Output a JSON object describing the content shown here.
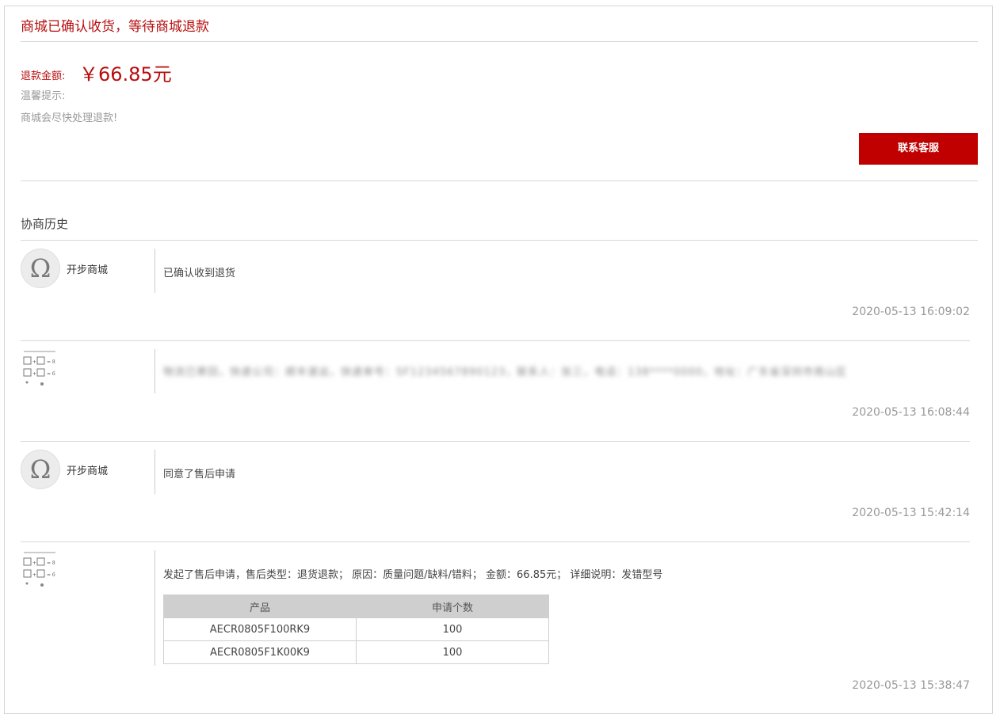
{
  "header": {
    "status_title": "商城已确认收货，等待商城退款"
  },
  "refund": {
    "amount_label": "退款金额:",
    "amount_value": "￥66.85元",
    "tip_label": "温馨提示:",
    "tip_text": "商城会尽快处理退款!",
    "contact_button": "联系客服"
  },
  "history": {
    "title": "协商历史",
    "entries": [
      {
        "author": "开步商城",
        "avatar": "omega-logo-icon",
        "message": "已确认收到退货",
        "time": "2020-05-13 16:09:02"
      },
      {
        "author": "",
        "avatar": "user-qr-avatar-icon",
        "message": "物流已寄回，快递公司：顺丰速运，快递单号：SF1234567890123，联系人：张三，电话：138****0000，地址：广东省深圳市南山区",
        "time": "2020-05-13 16:08:44"
      },
      {
        "author": "开步商城",
        "avatar": "omega-logo-icon",
        "message": "同意了售后申请",
        "time": "2020-05-13 15:42:14"
      },
      {
        "author": "",
        "avatar": "user-qr-avatar-icon",
        "message": "发起了售后申请，售后类型：退货退款； 原因：质量问题/缺料/错料； 金额：66.85元； 详细说明：发错型号",
        "time": "2020-05-13 15:38:47",
        "table": {
          "headers": [
            "产品",
            "申请个数"
          ],
          "rows": [
            [
              "AECR0805F100RK9",
              "100"
            ],
            [
              "AECR0805F1K00K9",
              "100"
            ]
          ]
        }
      }
    ]
  }
}
